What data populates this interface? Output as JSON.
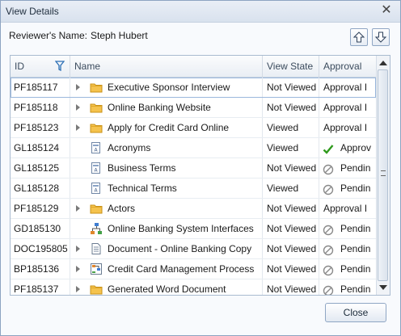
{
  "window": {
    "title": "View Details"
  },
  "reviewer": {
    "label": "Reviewer's Name:",
    "name": "Steph Hubert"
  },
  "grid": {
    "columns": [
      "ID",
      "Name",
      "View State",
      "Approval"
    ],
    "rows": [
      {
        "id": "PF185117",
        "name": "Executive Sponsor Interview",
        "type": "folder",
        "expandable": true,
        "view_state": "Not Viewed",
        "approval": "Approval I",
        "approval_icon": "none"
      },
      {
        "id": "PF185118",
        "name": "Online Banking Website",
        "type": "folder",
        "expandable": true,
        "view_state": "Not Viewed",
        "approval": "Approval I",
        "approval_icon": "none"
      },
      {
        "id": "PF185123",
        "name": "Apply for Credit Card Online",
        "type": "folder",
        "expandable": true,
        "view_state": "Viewed",
        "approval": "Approval I",
        "approval_icon": "none"
      },
      {
        "id": "GL185124",
        "name": "Acronyms",
        "type": "glossary",
        "expandable": false,
        "view_state": "Viewed",
        "approval": "Approv",
        "approval_icon": "check"
      },
      {
        "id": "GL185125",
        "name": "Business Terms",
        "type": "glossary",
        "expandable": false,
        "view_state": "Not Viewed",
        "approval": "Pendin",
        "approval_icon": "pending"
      },
      {
        "id": "GL185128",
        "name": "Technical Terms",
        "type": "glossary",
        "expandable": false,
        "view_state": "Viewed",
        "approval": "Pendin",
        "approval_icon": "pending"
      },
      {
        "id": "PF185129",
        "name": "Actors",
        "type": "folder",
        "expandable": true,
        "view_state": "Not Viewed",
        "approval": "Approval I",
        "approval_icon": "none"
      },
      {
        "id": "GD185130",
        "name": "Online Banking System Interfaces",
        "type": "diagram",
        "expandable": false,
        "view_state": "Not Viewed",
        "approval": "Pendin",
        "approval_icon": "pending"
      },
      {
        "id": "DOC195805",
        "name": "Document - Online Banking Copy",
        "type": "document",
        "expandable": true,
        "view_state": "Not Viewed",
        "approval": "Pendin",
        "approval_icon": "pending"
      },
      {
        "id": "BP185136",
        "name": "Credit Card Management Process",
        "type": "process",
        "expandable": true,
        "view_state": "Not Viewed",
        "approval": "Pendin",
        "approval_icon": "pending"
      },
      {
        "id": "PF185137",
        "name": "Generated Word Document",
        "type": "folder",
        "expandable": true,
        "view_state": "Not Viewed",
        "approval": "Pendin",
        "approval_icon": "pending"
      }
    ]
  },
  "buttons": {
    "close": "Close"
  },
  "colors": {
    "accent": "#8da3c1",
    "check": "#2f9a1c",
    "folder": "#f2c04a"
  }
}
